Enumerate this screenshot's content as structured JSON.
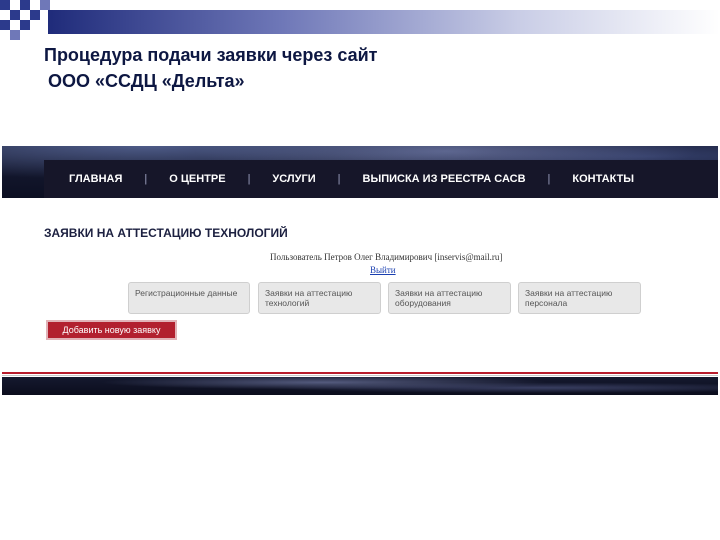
{
  "slide": {
    "title_line1": "Процедура подачи заявки через сайт",
    "title_line2": "ООО «ССДЦ «Дельта»"
  },
  "site": {
    "nav": {
      "items": [
        {
          "label": "ГЛАВНАЯ"
        },
        {
          "label": "О ЦЕНТРЕ"
        },
        {
          "label": "УСЛУГИ"
        },
        {
          "label": "ВЫПИСКА ИЗ РЕЕСТРА САСВ"
        },
        {
          "label": "КОНТАКТЫ"
        }
      ],
      "separator": "|"
    },
    "page_heading": "ЗАЯВКИ НА АТТЕСТАЦИЮ ТЕХНОЛОГИЙ",
    "user_line": "Пользователь Петров Олег Владимирович [inservis@mail.ru]",
    "logout_label": "Выйти",
    "tabs": [
      {
        "label": "Регистрационные данные"
      },
      {
        "label": "Заявки на аттестацию технологий"
      },
      {
        "label": "Заявки на аттестацию оборудования"
      },
      {
        "label": "Заявки на аттестацию персонала"
      }
    ],
    "add_button_label": "Добавить новую заявку"
  },
  "colors": {
    "slide_title": "#0d1742",
    "nav_background": "#161629",
    "button_red": "#b2202f",
    "link_blue": "#1a3fb0"
  }
}
